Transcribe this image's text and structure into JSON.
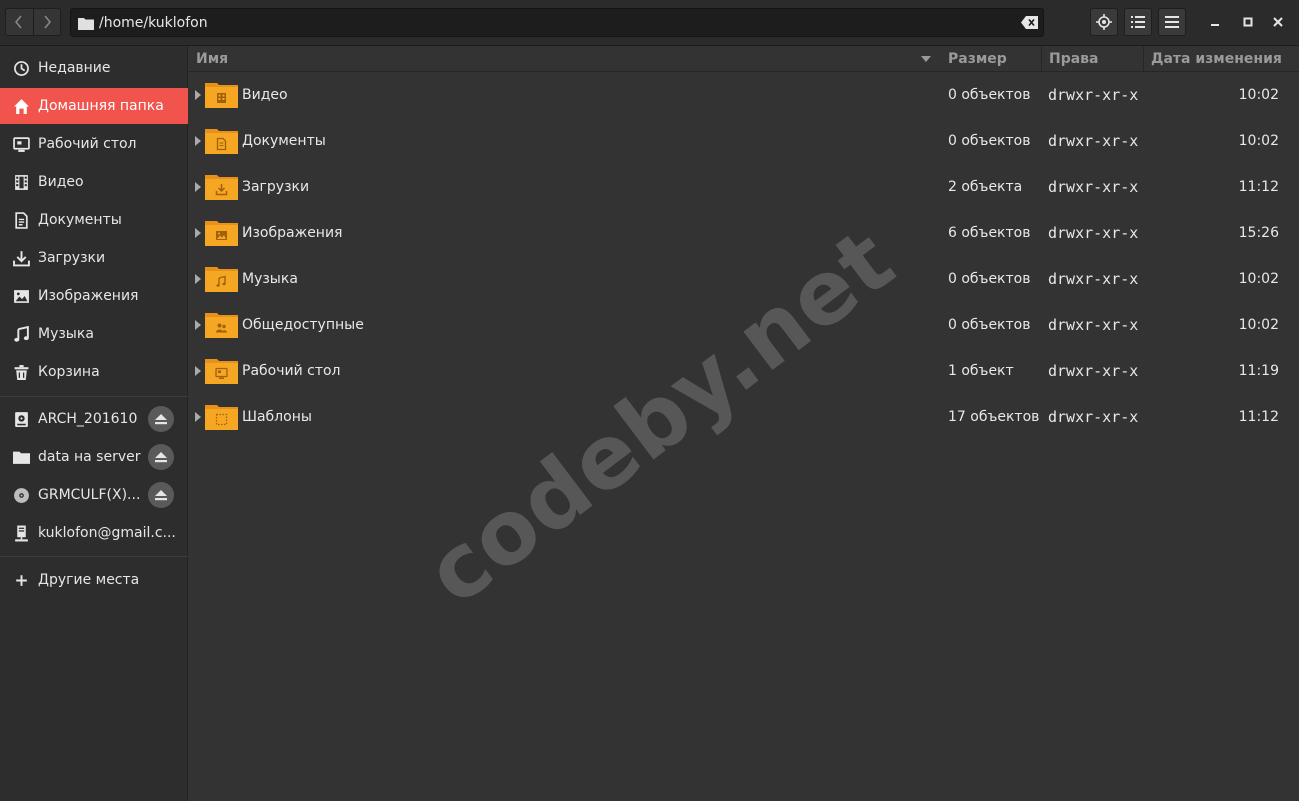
{
  "header": {
    "path": "/home/kuklofon"
  },
  "sidebar": {
    "places": [
      {
        "label": "Недавние",
        "icon": "recent-icon"
      },
      {
        "label": "Домашняя папка",
        "icon": "home-icon",
        "active": true
      },
      {
        "label": "Рабочий стол",
        "icon": "desktop-icon"
      },
      {
        "label": "Видео",
        "icon": "video-icon"
      },
      {
        "label": "Документы",
        "icon": "document-icon"
      },
      {
        "label": "Загрузки",
        "icon": "download-icon"
      },
      {
        "label": "Изображения",
        "icon": "image-icon"
      },
      {
        "label": "Музыка",
        "icon": "music-icon"
      },
      {
        "label": "Корзина",
        "icon": "trash-icon"
      }
    ],
    "devices": [
      {
        "label": "ARCH_201610",
        "icon": "drive-icon",
        "ejectable": true
      },
      {
        "label": "data на server",
        "icon": "network-folder-icon",
        "ejectable": true
      },
      {
        "label": "GRMCULF(X)...",
        "icon": "optical-disc-icon",
        "ejectable": true
      },
      {
        "label": "kuklofon@gmail.c...",
        "icon": "network-server-icon",
        "ejectable": false
      }
    ],
    "other_places": {
      "label": "Другие места",
      "icon": "plus-icon"
    }
  },
  "columns": {
    "name": "Имя",
    "size": "Размер",
    "permissions": "Права",
    "modified": "Дата изменения"
  },
  "files": [
    {
      "name": "Видео",
      "size": "0 объектов",
      "permissions": "drwxr-xr-x",
      "modified": "10:02",
      "emblem": "video"
    },
    {
      "name": "Документы",
      "size": "0 объектов",
      "permissions": "drwxr-xr-x",
      "modified": "10:02",
      "emblem": "document"
    },
    {
      "name": "Загрузки",
      "size": "2 объекта",
      "permissions": "drwxr-xr-x",
      "modified": "11:12",
      "emblem": "download"
    },
    {
      "name": "Изображения",
      "size": "6 объектов",
      "permissions": "drwxr-xr-x",
      "modified": "15:26",
      "emblem": "image"
    },
    {
      "name": "Музыка",
      "size": "0 объектов",
      "permissions": "drwxr-xr-x",
      "modified": "10:02",
      "emblem": "music"
    },
    {
      "name": "Общедоступные",
      "size": "0 объектов",
      "permissions": "drwxr-xr-x",
      "modified": "10:02",
      "emblem": "public"
    },
    {
      "name": "Рабочий стол",
      "size": "1 объект",
      "permissions": "drwxr-xr-x",
      "modified": "11:19",
      "emblem": "desktop"
    },
    {
      "name": "Шаблоны",
      "size": "17 объектов",
      "permissions": "drwxr-xr-x",
      "modified": "11:12",
      "emblem": "templates"
    }
  ],
  "watermark": "codeby.net",
  "colors": {
    "accent": "#f0544c",
    "folder": "#f5a623"
  }
}
